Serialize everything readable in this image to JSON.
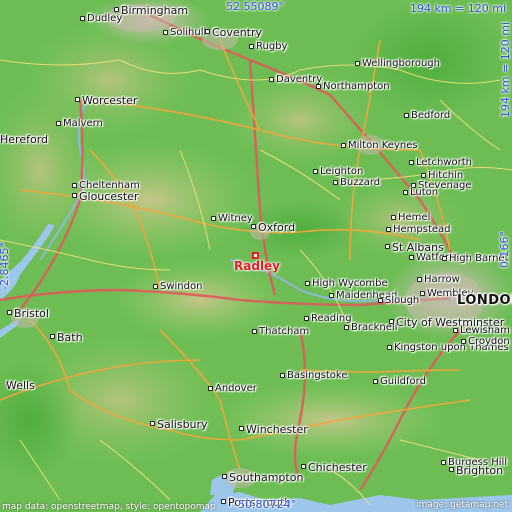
{
  "coords": {
    "top": "52.55089°",
    "bottom": "50.80724°",
    "left": "-2.8465°",
    "right": "0.166°"
  },
  "scale": {
    "horizontal": "194 km = 120 mi",
    "vertical": "194 km = 120 mi"
  },
  "target_city": "Radley",
  "cities": [
    {
      "name": "Birmingham",
      "cls": "big"
    },
    {
      "name": "Dudley",
      "cls": ""
    },
    {
      "name": "Solihull",
      "cls": ""
    },
    {
      "name": "Coventry",
      "cls": "big"
    },
    {
      "name": "Rugby",
      "cls": ""
    },
    {
      "name": "Daventry",
      "cls": ""
    },
    {
      "name": "Wellingborough",
      "cls": ""
    },
    {
      "name": "Northampton",
      "cls": ""
    },
    {
      "name": "Worcester",
      "cls": "big"
    },
    {
      "name": "Malvern",
      "cls": ""
    },
    {
      "name": "Hereford",
      "cls": "big"
    },
    {
      "name": "Bedford",
      "cls": ""
    },
    {
      "name": "Milton Keynes",
      "cls": ""
    },
    {
      "name": "Leighton",
      "cls": ""
    },
    {
      "name": "Buzzard",
      "cls": ""
    },
    {
      "name": "Letchworth",
      "cls": ""
    },
    {
      "name": "Hitchin",
      "cls": ""
    },
    {
      "name": "Stevenage",
      "cls": ""
    },
    {
      "name": "Luton",
      "cls": ""
    },
    {
      "name": "Cheltenham",
      "cls": ""
    },
    {
      "name": "Gloucester",
      "cls": "big"
    },
    {
      "name": "Witney",
      "cls": ""
    },
    {
      "name": "Oxford",
      "cls": "big"
    },
    {
      "name": "Hemel",
      "cls": ""
    },
    {
      "name": "Hempstead",
      "cls": ""
    },
    {
      "name": "St Albans",
      "cls": "big"
    },
    {
      "name": "Watford",
      "cls": ""
    },
    {
      "name": "High Barnet",
      "cls": ""
    },
    {
      "name": "Swindon",
      "cls": ""
    },
    {
      "name": "High Wycombe",
      "cls": ""
    },
    {
      "name": "Maidenhead",
      "cls": ""
    },
    {
      "name": "Harrow",
      "cls": ""
    },
    {
      "name": "Wembley",
      "cls": ""
    },
    {
      "name": "LONDON",
      "cls": "huge"
    },
    {
      "name": "Slough",
      "cls": ""
    },
    {
      "name": "Bristol",
      "cls": "big"
    },
    {
      "name": "Reading",
      "cls": ""
    },
    {
      "name": "Bracknell",
      "cls": ""
    },
    {
      "name": "City of Westminster",
      "cls": "big"
    },
    {
      "name": "Bath",
      "cls": "big"
    },
    {
      "name": "Thatcham",
      "cls": ""
    },
    {
      "name": "Kingston upon Thames",
      "cls": ""
    },
    {
      "name": "Lewisham",
      "cls": ""
    },
    {
      "name": "Croydon",
      "cls": ""
    },
    {
      "name": "Wells",
      "cls": "big"
    },
    {
      "name": "Basingstoke",
      "cls": ""
    },
    {
      "name": "Guildford",
      "cls": ""
    },
    {
      "name": "Andover",
      "cls": ""
    },
    {
      "name": "Salisbury",
      "cls": "big"
    },
    {
      "name": "Winchester",
      "cls": "big"
    },
    {
      "name": "Burgess Hill",
      "cls": ""
    },
    {
      "name": "Southampton",
      "cls": "big"
    },
    {
      "name": "Chichester",
      "cls": "big"
    },
    {
      "name": "Brighton",
      "cls": "big"
    },
    {
      "name": "Portsmouth",
      "cls": "big"
    }
  ],
  "attribution": "map data: openstreetmap, style: opentopomap",
  "attribution_right": "image: getamap.net"
}
